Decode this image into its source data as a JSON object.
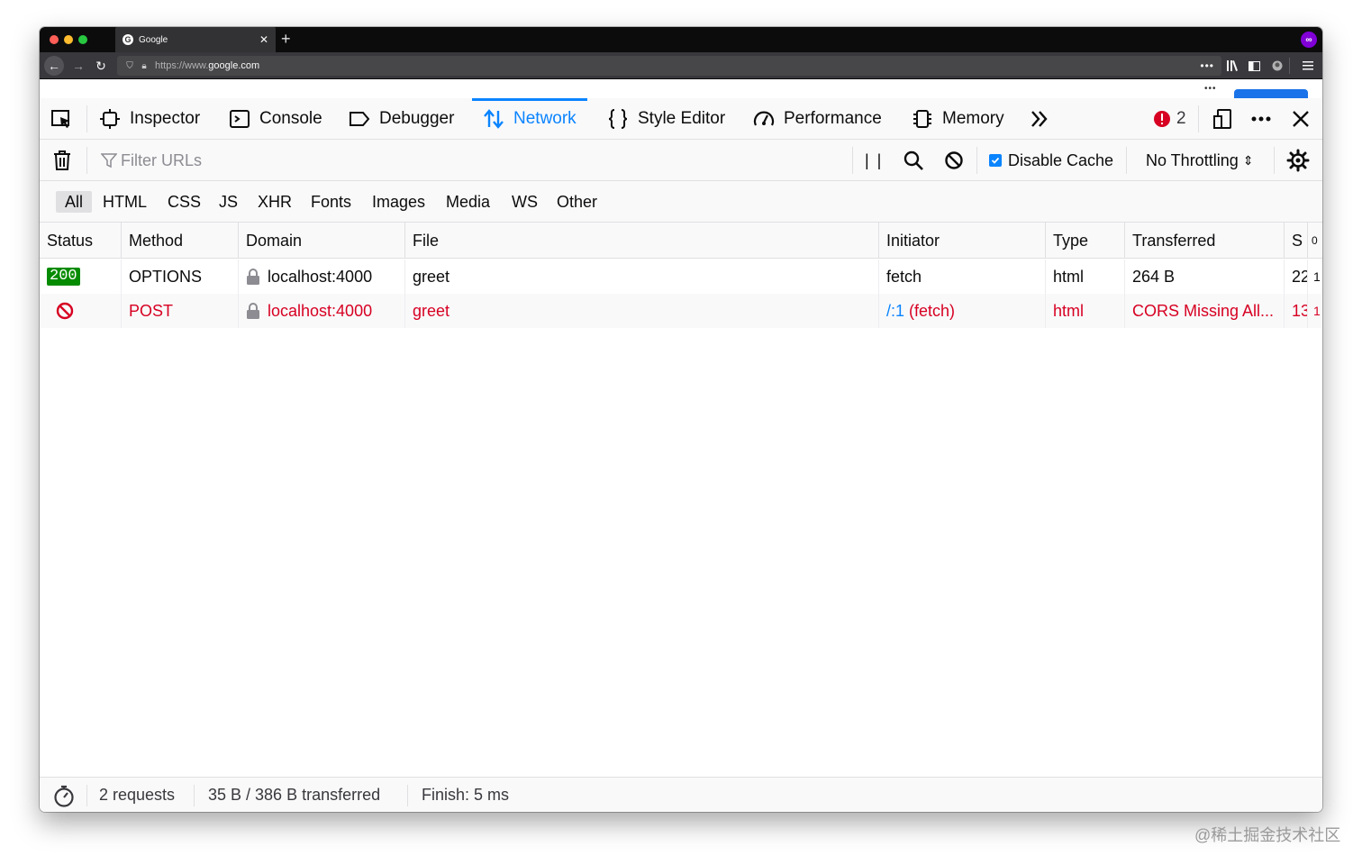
{
  "browser": {
    "tab_title": "Google",
    "tab_favicon_letter": "G",
    "tab_close": "✕",
    "new_tab": "+",
    "url_prefix": "https://www.",
    "url_domain": "google.com",
    "url_more": "•••"
  },
  "devtools": {
    "tools": [
      {
        "label": "Inspector"
      },
      {
        "label": "Console"
      },
      {
        "label": "Debugger"
      },
      {
        "label": "Network"
      },
      {
        "label": "Style Editor"
      },
      {
        "label": "Performance"
      },
      {
        "label": "Memory"
      }
    ],
    "error_count": "2"
  },
  "network": {
    "filter_placeholder": "Filter URLs",
    "pause_label": "| |",
    "disable_cache_label": "Disable Cache",
    "disable_cache_checked": true,
    "throttling_label": "No Throttling",
    "throttling_arrows": "⇕",
    "type_filters": [
      "All",
      "HTML",
      "CSS",
      "JS",
      "XHR",
      "Fonts",
      "Images",
      "Media",
      "WS",
      "Other"
    ],
    "selected_type": "All",
    "columns": [
      "Status",
      "Method",
      "Domain",
      "File",
      "Initiator",
      "Type",
      "Transferred",
      "S",
      "0"
    ],
    "rows": [
      {
        "status": "200",
        "method": "OPTIONS",
        "domain": "localhost:4000",
        "file": "greet",
        "initiator": "fetch",
        "initiator_link": "",
        "type": "html",
        "transferred": "264 B",
        "size": "22",
        "extra": "1"
      },
      {
        "status": "blocked",
        "method": "POST",
        "domain": "localhost:4000",
        "file": "greet",
        "initiator": " (fetch)",
        "initiator_link": "/:1",
        "type": "html",
        "transferred": "CORS Missing All...",
        "size": "13",
        "extra": "1"
      }
    ]
  },
  "footer": {
    "requests": "2 requests",
    "transferred": "35 B / 386 B transferred",
    "finish": "Finish: 5 ms"
  },
  "watermark": "@稀土掘金技术社区",
  "colors": {
    "accent": "#0a84ff",
    "error": "#d70022",
    "status_ok": "#058b00"
  }
}
